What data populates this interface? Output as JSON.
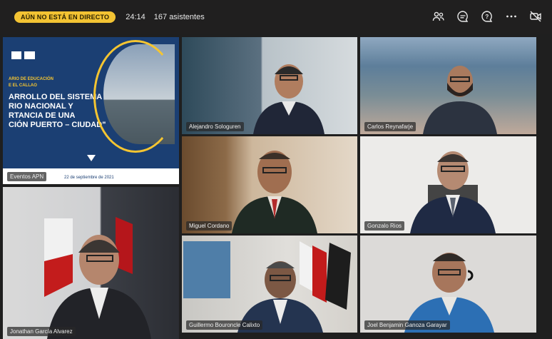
{
  "topbar": {
    "status_badge": "AÚN NO ESTÁ EN DIRECTO",
    "timer": "24:14",
    "attendees": "167 asistentes",
    "icons": [
      "people-icon",
      "chat-icon",
      "qa-icon",
      "more-icon",
      "camera-off-icon"
    ]
  },
  "slide": {
    "line1": "ARIO DE EDUCACIÓN",
    "line2": "E EL CALLAO",
    "title_lines": [
      "ARROLLO DEL SISTEMA",
      "RIO NACIONAL Y",
      "RTANCIA DE UNA",
      "CIÓN PUERTO – CIUDAD\""
    ],
    "date": "22 de septiembre de 2021"
  },
  "participants": [
    {
      "name": "Eventos APN"
    },
    {
      "name": "Alejandro Sologuren"
    },
    {
      "name": "Carlos Reynafarje"
    },
    {
      "name": "Miguel Cordano"
    },
    {
      "name": "Gonzalo Rios"
    },
    {
      "name": "Jonathan García Alvarez"
    },
    {
      "name": "Guillermo Bouroncle Calixto"
    },
    {
      "name": "Joel Benjamin Ganoza Garayar"
    }
  ],
  "colors": {
    "accent": "#f3c333",
    "topbar": "#201f1f",
    "slide_blue": "#1b3f73"
  }
}
